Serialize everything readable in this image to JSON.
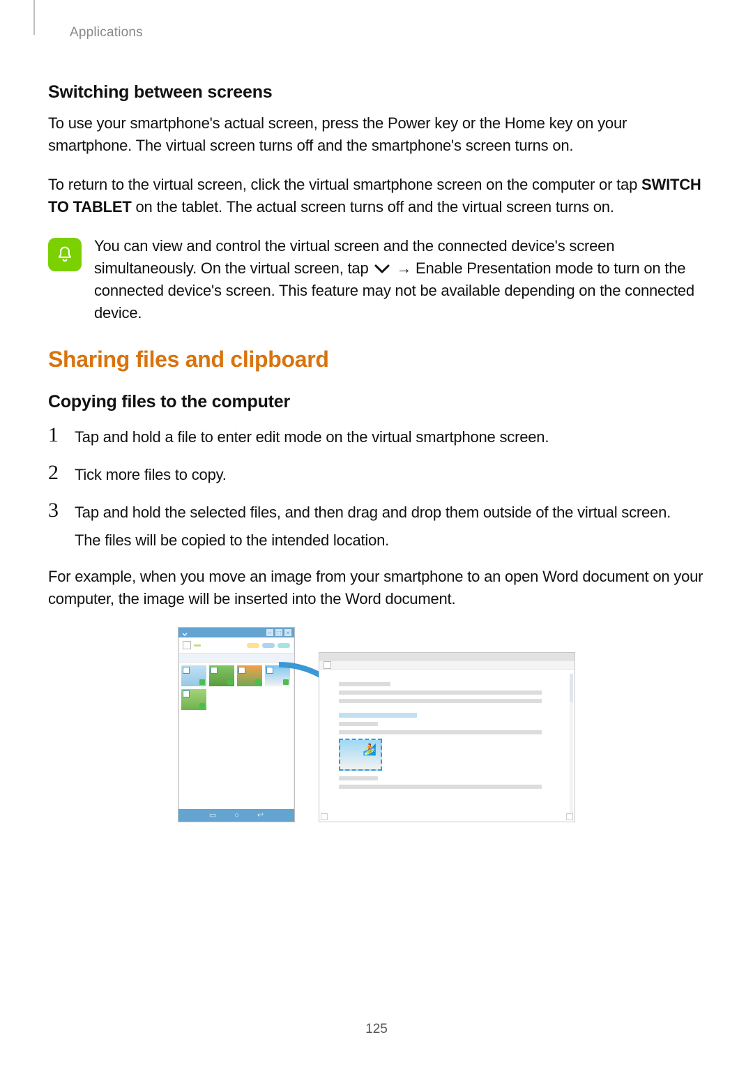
{
  "header": {
    "section_label": "Applications"
  },
  "sub1": {
    "title": "Switching between screens",
    "p1": "To use your smartphone's actual screen, press the Power key or the Home key on your smartphone. The virtual screen turns off and the smartphone's screen turns on.",
    "p2_pre": "To return to the virtual screen, click the virtual smartphone screen on the computer or tap ",
    "p2_strong": "SWITCH TO TABLET",
    "p2_post": " on the tablet. The actual screen turns off and the virtual screen turns on."
  },
  "note": {
    "pre": "You can view and control the virtual screen and the connected device's screen simultaneously. On the virtual screen, tap ",
    "arrow": " → ",
    "strong": "Enable Presentation mode",
    "post": " to turn on the connected device's screen. This feature may not be available depending on the connected device."
  },
  "section2": {
    "title": "Sharing files and clipboard"
  },
  "sub2": {
    "title": "Copying files to the computer"
  },
  "steps": {
    "n1": "1",
    "t1": "Tap and hold a file to enter edit mode on the virtual smartphone screen.",
    "n2": "2",
    "t2": "Tick more files to copy.",
    "n3": "3",
    "t3": "Tap and hold the selected files, and then drag and drop them outside of the virtual screen.",
    "t3b": "The files will be copied to the intended location."
  },
  "example": "For example, when you move an image from your smartphone to an open Word document on your computer, the image will be inserted into the Word document.",
  "pagenum": "125",
  "icons": {
    "bell": "bell-icon",
    "chevdown": "chevron-down-icon"
  }
}
